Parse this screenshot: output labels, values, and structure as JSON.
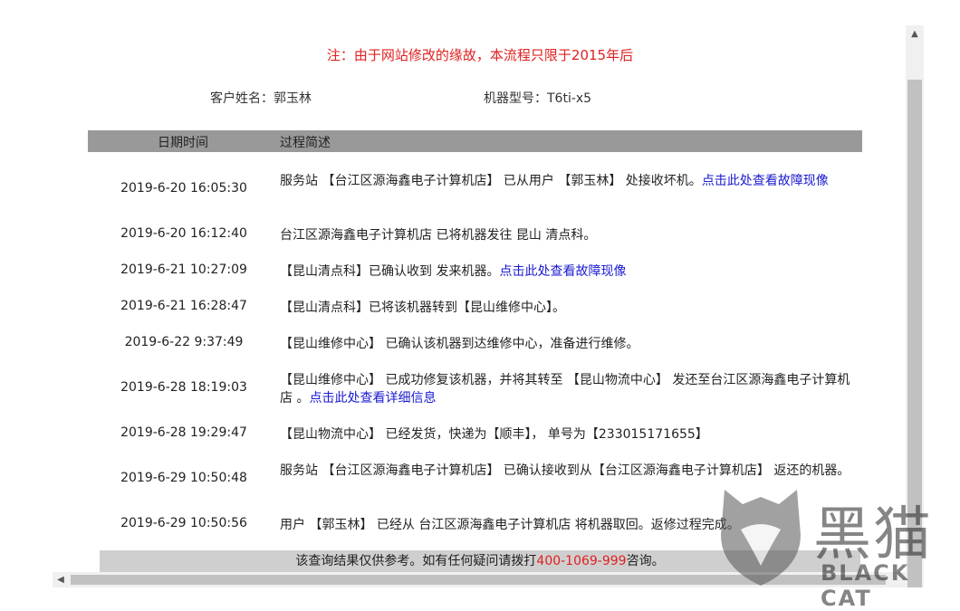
{
  "notice": "注：由于网站修改的缘故，本流程只限于2015年后",
  "customer": {
    "label": "客户姓名：",
    "name": "郭玉林"
  },
  "machine": {
    "label": "机器型号：",
    "model": "T6ti-x5"
  },
  "table": {
    "header_date": "日期时间",
    "header_desc": "过程简述",
    "rows": [
      {
        "date": "2019-6-20 16:05:30",
        "text": "服务站 【台江区源海鑫电子计算机店】 已从用户 【郭玉林】 处接收坏机。",
        "link": "点击此处查看故障现像"
      },
      {
        "date": "2019-6-20 16:12:40",
        "text": "台江区源海鑫电子计算机店 已将机器发往 昆山 清点科。",
        "link": ""
      },
      {
        "date": "2019-6-21 10:27:09",
        "text": "【昆山清点科】已确认收到 发来机器。",
        "link": "点击此处查看故障现像"
      },
      {
        "date": "2019-6-21 16:28:47",
        "text": "【昆山清点科】已将该机器转到【昆山维修中心】。",
        "link": ""
      },
      {
        "date": "2019-6-22 9:37:49",
        "text": "【昆山维修中心】 已确认该机器到达维修中心，准备进行维修。",
        "link": ""
      },
      {
        "date": "2019-6-28 18:19:03",
        "text": "【昆山维修中心】 已成功修复该机器，并将其转至 【昆山物流中心】 发还至台江区源海鑫电子计算机店 。",
        "link": "点击此处查看详细信息"
      },
      {
        "date": "2019-6-28 19:29:47",
        "text": "【昆山物流中心】 已经发货，快递为【顺丰】， 单号为【233015171655】",
        "link": ""
      },
      {
        "date": "2019-6-29 10:50:48",
        "text": "服务站 【台江区源海鑫电子计算机店】 已确认接收到从【台江区源海鑫电子计算机店】 返还的机器。",
        "link": ""
      },
      {
        "date": "2019-6-29 10:50:56",
        "text": "用户 【郭玉林】 已经从 台江区源海鑫电子计算机店 将机器取回。返修过程完成。",
        "link": ""
      }
    ]
  },
  "footer": {
    "before": "该查询结果仅供参考。如有任何疑问请拨打",
    "phone": "400-1069-999",
    "after": "咨询。"
  },
  "watermark": {
    "cn": "黑猫",
    "en": "BLACK CAT"
  },
  "colors": {
    "notice": "#e02020",
    "link": "#1a1ad0",
    "header_bg": "#999999",
    "footer_bg": "#cfcfcf"
  }
}
